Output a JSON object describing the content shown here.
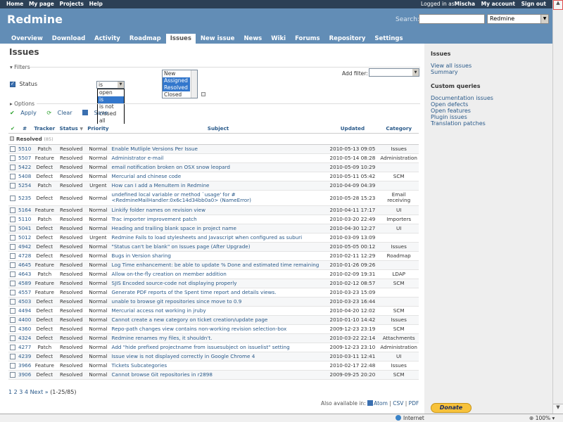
{
  "top_menu": {
    "left": [
      "Home",
      "My page",
      "Projects",
      "Help"
    ],
    "logged_in": "Logged in as ",
    "user": "Mischa",
    "my_account": "My account",
    "sign_out": "Sign out"
  },
  "header": {
    "title": "Redmine",
    "search_label": "Search:",
    "project_select": "Redmine",
    "tabs": [
      "Overview",
      "Download",
      "Activity",
      "Roadmap",
      "Issues",
      "New issue",
      "News",
      "Wiki",
      "Forums",
      "Repository",
      "Settings"
    ],
    "selected_tab": "Issues"
  },
  "page": {
    "title": "Issues",
    "filters_legend": "Filters",
    "options_legend": "Options",
    "status_label": "Status",
    "operator_value": "is",
    "operator_options": [
      "open",
      "is",
      "is not",
      "closed",
      "all"
    ],
    "operator_selected": "is",
    "status_values": [
      {
        "label": "New",
        "selected": false
      },
      {
        "label": "Assigned",
        "selected": true
      },
      {
        "label": "Resolved",
        "selected": true
      },
      {
        "label": "Closed",
        "selected": false
      }
    ],
    "add_filter_label": "Add filter:",
    "apply": "Apply",
    "clear": "Clear",
    "save": "Save"
  },
  "table": {
    "headers": {
      "id": "#",
      "tracker": "Tracker",
      "status": "Status",
      "priority": "Priority",
      "subject": "Subject",
      "updated": "Updated",
      "category": "Category"
    },
    "group": {
      "label": "Resolved",
      "count": "(85)"
    },
    "rows": [
      {
        "id": "5510",
        "tracker": "Patch",
        "status": "Resolved",
        "priority": "Normal",
        "subject": "Enable Mutliple Versions Per Issue",
        "updated": "2010-05-13 09:05",
        "category": "Issues"
      },
      {
        "id": "5507",
        "tracker": "Feature",
        "status": "Resolved",
        "priority": "Normal",
        "subject": "Administrator e-mail",
        "updated": "2010-05-14 08:28",
        "category": "Administration"
      },
      {
        "id": "5422",
        "tracker": "Defect",
        "status": "Resolved",
        "priority": "Normal",
        "subject": "email notification broken on OSX snow leopard",
        "updated": "2010-05-09 10:29",
        "category": ""
      },
      {
        "id": "5408",
        "tracker": "Defect",
        "status": "Resolved",
        "priority": "Normal",
        "subject": "Mercurial and chinese code",
        "updated": "2010-05-11 05:42",
        "category": "SCM"
      },
      {
        "id": "5254",
        "tracker": "Patch",
        "status": "Resolved",
        "priority": "Urgent",
        "subject": "How can I add a MenuItem in Redmine",
        "updated": "2010-04-09 04:39",
        "category": ""
      },
      {
        "id": "5235",
        "tracker": "Defect",
        "status": "Resolved",
        "priority": "Normal",
        "subject": "undefined local variable or method `usage' for #<RedmineMailHandler:0x6c14d34bb0a0> (NameError)",
        "updated": "2010-05-28 15:23",
        "category": "Email receiving"
      },
      {
        "id": "5164",
        "tracker": "Feature",
        "status": "Resolved",
        "priority": "Normal",
        "subject": "Linkify folder names on revision view",
        "updated": "2010-04-11 17:17",
        "category": "UI"
      },
      {
        "id": "5110",
        "tracker": "Patch",
        "status": "Resolved",
        "priority": "Normal",
        "subject": "Trac importer improvement patch",
        "updated": "2010-03-20 22:49",
        "category": "Importers"
      },
      {
        "id": "5041",
        "tracker": "Defect",
        "status": "Resolved",
        "priority": "Normal",
        "subject": "Heading and trailing blank space in project name",
        "updated": "2010-04-30 12:27",
        "category": "UI"
      },
      {
        "id": "5012",
        "tracker": "Defect",
        "status": "Resolved",
        "priority": "Urgent",
        "subject": "Redmine Fails to load stylesheets and Javascript when configured as suburi",
        "updated": "2010-03-09 13:09",
        "category": ""
      },
      {
        "id": "4942",
        "tracker": "Defect",
        "status": "Resolved",
        "priority": "Normal",
        "subject": "\"Status can't be blank\" on Issues page (After Upgrade)",
        "updated": "2010-05-05 00:12",
        "category": "Issues"
      },
      {
        "id": "4728",
        "tracker": "Defect",
        "status": "Resolved",
        "priority": "Normal",
        "subject": "Bugs in Version sharing",
        "updated": "2010-02-11 12:29",
        "category": "Roadmap"
      },
      {
        "id": "4645",
        "tracker": "Feature",
        "status": "Resolved",
        "priority": "Normal",
        "subject": "Log Time enhancement: be able to update % Done and estimated time remaining",
        "updated": "2010-01-26 09:26",
        "category": ""
      },
      {
        "id": "4643",
        "tracker": "Patch",
        "status": "Resolved",
        "priority": "Normal",
        "subject": "Allow on-the-fly creation on member addition",
        "updated": "2010-02-09 19:31",
        "category": "LDAP"
      },
      {
        "id": "4589",
        "tracker": "Feature",
        "status": "Resolved",
        "priority": "Normal",
        "subject": "SJIS Encoded source-code not displaying properly",
        "updated": "2010-02-12 08:57",
        "category": "SCM"
      },
      {
        "id": "4557",
        "tracker": "Feature",
        "status": "Resolved",
        "priority": "Normal",
        "subject": "Generate PDF reports of the Spent time report and details views.",
        "updated": "2010-03-23 15:09",
        "category": ""
      },
      {
        "id": "4503",
        "tracker": "Defect",
        "status": "Resolved",
        "priority": "Normal",
        "subject": "unable to browse git repositories since move to 0.9",
        "updated": "2010-03-23 16:44",
        "category": ""
      },
      {
        "id": "4494",
        "tracker": "Defect",
        "status": "Resolved",
        "priority": "Normal",
        "subject": "Mercurial access not working in jruby",
        "updated": "2010-04-20 12:02",
        "category": "SCM"
      },
      {
        "id": "4400",
        "tracker": "Defect",
        "status": "Resolved",
        "priority": "Normal",
        "subject": "Cannot create a new category on ticket creation/update page",
        "updated": "2010-01-10 14:42",
        "category": "Issues"
      },
      {
        "id": "4360",
        "tracker": "Defect",
        "status": "Resolved",
        "priority": "Normal",
        "subject": "Repo-path changes view contains non-working revision selection-box",
        "updated": "2009-12-23 23:19",
        "category": "SCM"
      },
      {
        "id": "4324",
        "tracker": "Defect",
        "status": "Resolved",
        "priority": "Normal",
        "subject": "Redmine renames my files, it shouldn't.",
        "updated": "2010-03-22 22:14",
        "category": "Attachments"
      },
      {
        "id": "4277",
        "tracker": "Patch",
        "status": "Resolved",
        "priority": "Normal",
        "subject": "Add \"hide prefixed projectname from issuesubject on issuelist\" setting",
        "updated": "2009-12-23 23:10",
        "category": "Administration"
      },
      {
        "id": "4239",
        "tracker": "Defect",
        "status": "Resolved",
        "priority": "Normal",
        "subject": "Issue view is not displayed correctly in Google Chrome 4",
        "updated": "2010-03-11 12:41",
        "category": "UI"
      },
      {
        "id": "3966",
        "tracker": "Feature",
        "status": "Resolved",
        "priority": "Normal",
        "subject": "Tickets Subcategories",
        "updated": "2010-02-17 22:48",
        "category": "Issues"
      },
      {
        "id": "3906",
        "tracker": "Defect",
        "status": "Resolved",
        "priority": "Normal",
        "subject": "Cannot browse Git repositories in r2898",
        "updated": "2009-09-25 20:20",
        "category": "SCM"
      }
    ]
  },
  "pagination": {
    "pages": [
      "1",
      "2",
      "3",
      "4"
    ],
    "next": "Next »",
    "range": "(1-25/85)"
  },
  "also_available": {
    "label": "Also available in:",
    "formats": [
      "Atom",
      "CSV",
      "PDF"
    ]
  },
  "sidebar": {
    "issues_heading": "Issues",
    "issues_links": [
      "View all issues",
      "Summary"
    ],
    "custom_heading": "Custom queries",
    "custom_links": [
      "Documentation issues",
      "Open defects",
      "Open features",
      "Plugin issues",
      "Translation patches"
    ],
    "donate": "Donate"
  },
  "statusbar": {
    "zone": "Internet",
    "zoom": "100%"
  }
}
